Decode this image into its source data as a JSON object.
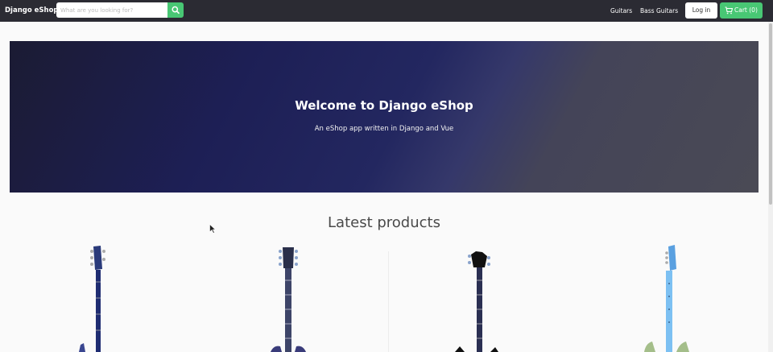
{
  "navbar": {
    "brand": "Django eShop",
    "search_placeholder": "What are you looking for?",
    "links": [
      "Guitars",
      "Bass Guitars"
    ],
    "login_label": "Log in",
    "cart_label": "Cart (0)"
  },
  "hero": {
    "title": "Welcome to Django eShop",
    "subtitle": "An eShop app written in Django and Vue"
  },
  "products": {
    "heading": "Latest products"
  },
  "colors": {
    "navbar": "#2b2b33",
    "accent_green": "#48c774",
    "hero_blue": "#1d1f55"
  },
  "icons": [
    "search-icon",
    "cart-icon",
    "mouse-cursor"
  ]
}
